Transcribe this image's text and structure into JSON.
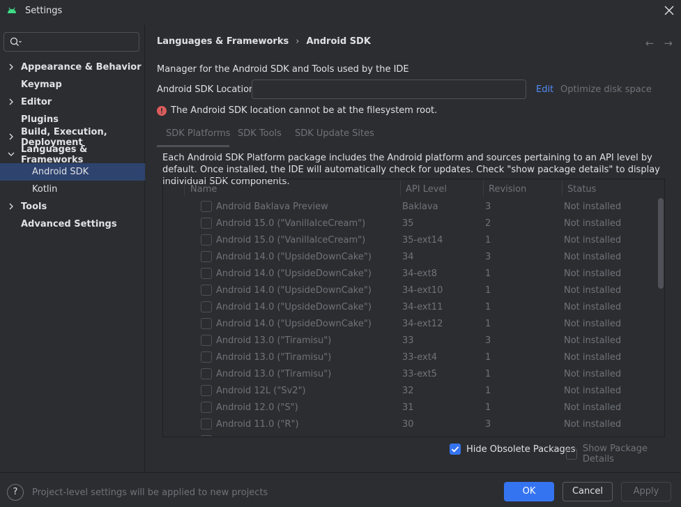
{
  "window": {
    "title": "Settings"
  },
  "search": {
    "placeholder": ""
  },
  "sidebar": {
    "items": [
      {
        "label": "Appearance & Behavior",
        "expandable": true,
        "expanded": false
      },
      {
        "label": "Keymap",
        "expandable": false
      },
      {
        "label": "Editor",
        "expandable": true,
        "expanded": false
      },
      {
        "label": "Plugins",
        "expandable": false
      },
      {
        "label": "Build, Execution, Deployment",
        "expandable": true,
        "expanded": false
      },
      {
        "label": "Languages & Frameworks",
        "expandable": true,
        "expanded": true
      },
      {
        "label": "Android SDK",
        "child": true,
        "selected": true
      },
      {
        "label": "Kotlin",
        "child": true
      },
      {
        "label": "Tools",
        "expandable": true,
        "expanded": false
      },
      {
        "label": "Advanced Settings",
        "expandable": false
      }
    ]
  },
  "breadcrumb": {
    "parent": "Languages & Frameworks",
    "separator": "›",
    "current": "Android SDK"
  },
  "main": {
    "description": "Manager for the Android SDK and Tools used by the IDE",
    "location_label": "Android SDK Location:",
    "location_value": "",
    "edit_link": "Edit",
    "optimize_link": "Optimize disk space",
    "error_text": "The Android SDK location cannot be at the filesystem root."
  },
  "tabs": [
    {
      "label": "SDK Platforms",
      "active": true
    },
    {
      "label": "SDK Tools"
    },
    {
      "label": "SDK Update Sites"
    }
  ],
  "package_description": "Each Android SDK Platform package includes the Android platform and sources pertaining to an API level by default. Once installed, the IDE will automatically check for updates. Check \"show package details\" to display individual SDK components.",
  "table": {
    "headers": [
      "Name",
      "API Level",
      "Revision",
      "Status"
    ],
    "rows": [
      {
        "name": "Android Baklava Preview",
        "api": "Baklava",
        "rev": "3",
        "status": "Not installed"
      },
      {
        "name": "Android 15.0 (\"VanillaIceCream\")",
        "api": "35",
        "rev": "2",
        "status": "Not installed"
      },
      {
        "name": "Android 15.0 (\"VanillaIceCream\")",
        "api": "35-ext14",
        "rev": "1",
        "status": "Not installed"
      },
      {
        "name": "Android 14.0 (\"UpsideDownCake\")",
        "api": "34",
        "rev": "3",
        "status": "Not installed"
      },
      {
        "name": "Android 14.0 (\"UpsideDownCake\")",
        "api": "34-ext8",
        "rev": "1",
        "status": "Not installed"
      },
      {
        "name": "Android 14.0 (\"UpsideDownCake\")",
        "api": "34-ext10",
        "rev": "1",
        "status": "Not installed"
      },
      {
        "name": "Android 14.0 (\"UpsideDownCake\")",
        "api": "34-ext11",
        "rev": "1",
        "status": "Not installed"
      },
      {
        "name": "Android 14.0 (\"UpsideDownCake\")",
        "api": "34-ext12",
        "rev": "1",
        "status": "Not installed"
      },
      {
        "name": "Android 13.0 (\"Tiramisu\")",
        "api": "33",
        "rev": "3",
        "status": "Not installed"
      },
      {
        "name": "Android 13.0 (\"Tiramisu\")",
        "api": "33-ext4",
        "rev": "1",
        "status": "Not installed"
      },
      {
        "name": "Android 13.0 (\"Tiramisu\")",
        "api": "33-ext5",
        "rev": "1",
        "status": "Not installed"
      },
      {
        "name": "Android 12L (\"Sv2\")",
        "api": "32",
        "rev": "1",
        "status": "Not installed"
      },
      {
        "name": "Android 12.0 (\"S\")",
        "api": "31",
        "rev": "1",
        "status": "Not installed"
      },
      {
        "name": "Android 11.0 (\"R\")",
        "api": "30",
        "rev": "3",
        "status": "Not installed"
      }
    ]
  },
  "options": {
    "hide_obsolete": {
      "label": "Hide Obsolete Packages",
      "checked": true
    },
    "show_details": {
      "label": "Show Package Details",
      "checked": false
    }
  },
  "footer": {
    "help": "?",
    "text": "Project-level settings will be applied to new projects",
    "ok": "OK",
    "cancel": "Cancel",
    "apply": "Apply"
  },
  "colors": {
    "accent": "#3574f0",
    "link": "#548af7",
    "error": "#db5c5c",
    "selection": "#2e436e",
    "android": "#3ddc84"
  }
}
